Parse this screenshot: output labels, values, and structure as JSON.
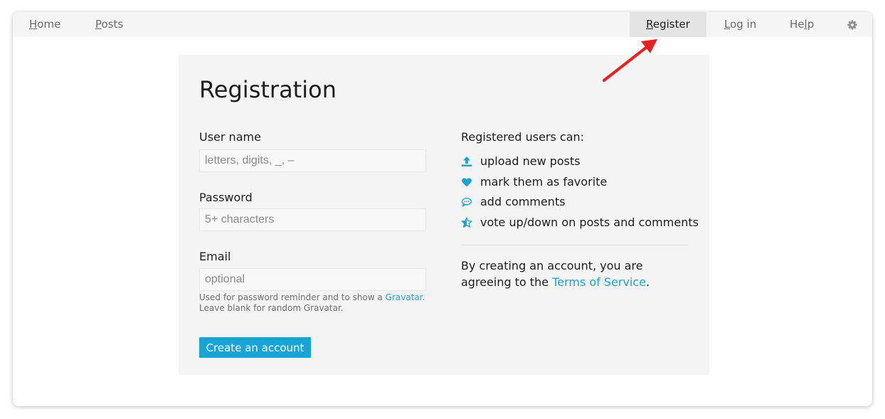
{
  "nav": {
    "home": "Home",
    "posts": "Posts",
    "register": "Register",
    "login": "Log in",
    "help": "Help",
    "settings_icon": "gear-icon"
  },
  "form": {
    "title": "Registration",
    "username_label": "User name",
    "username_placeholder": "letters, digits, _, –",
    "password_label": "Password",
    "password_placeholder": "5+ characters",
    "email_label": "Email",
    "email_placeholder": "optional",
    "email_help_prefix": "Used for password reminder and to show a ",
    "email_help_link": "Gravatar",
    "email_help_suffix": ". Leave blank for random Gravatar.",
    "submit_label": "Create an account"
  },
  "info": {
    "title": "Registered users can:",
    "features": [
      {
        "icon": "upload-icon",
        "text": "upload new posts"
      },
      {
        "icon": "heart-icon",
        "text": "mark them as favorite"
      },
      {
        "icon": "comment-icon",
        "text": "add comments"
      },
      {
        "icon": "star-icon",
        "text": "vote up/down on posts and comments"
      }
    ],
    "terms_prefix": "By creating an account, you are agreeing to the ",
    "terms_link": "Terms of Service",
    "terms_suffix": "."
  },
  "colors": {
    "accent": "#19a4d6",
    "annotation_arrow": "#e8201f",
    "topbar": "#f5f5f5",
    "panel": "#f4f4f4"
  }
}
